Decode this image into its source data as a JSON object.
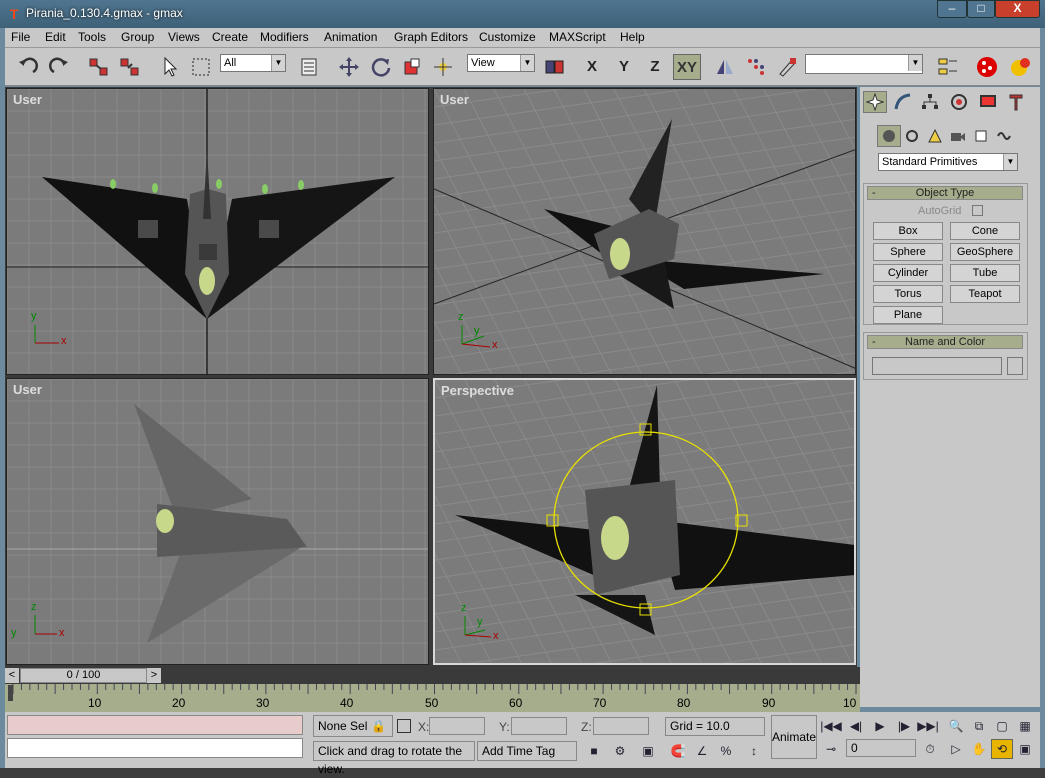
{
  "window": {
    "title": "Pirania_0.130.4.gmax - gmax",
    "min_label": "–",
    "max_label": "□",
    "close_label": "X"
  },
  "menu": [
    "File",
    "Edit",
    "Tools",
    "Group",
    "Views",
    "Create",
    "Modifiers",
    "Animation",
    "Graph Editors",
    "Customize",
    "MAXScript",
    "Help"
  ],
  "toolbar": {
    "selection_filter": "All",
    "ref_coord": "View",
    "axis_x": "X",
    "axis_y": "Y",
    "axis_z": "Z",
    "axis_xy": "XY",
    "named_selection": ""
  },
  "viewports": {
    "top_left": "User",
    "top_right": "User",
    "bottom_left": "User",
    "bottom_right": "Perspective"
  },
  "axes": {
    "x": "x",
    "y": "y",
    "z": "z"
  },
  "command_panel": {
    "category": "Standard Primitives",
    "object_type_title": "Object Type",
    "autogrid_label": "AutoGrid",
    "buttons": [
      "Box",
      "Cone",
      "Sphere",
      "GeoSphere",
      "Cylinder",
      "Tube",
      "Torus",
      "Teapot",
      "Plane"
    ],
    "name_color_title": "Name and Color",
    "collapse": "-"
  },
  "time": {
    "slider_label": "0 / 100",
    "prev": "<",
    "next": ">",
    "ticks": [
      "10",
      "20",
      "30",
      "40",
      "50",
      "60",
      "70",
      "80",
      "90",
      "10"
    ]
  },
  "status": {
    "selection": "None Sel",
    "x_label": "X:",
    "y_label": "Y:",
    "z_label": "Z:",
    "x_value": "",
    "y_value": "",
    "z_value": "",
    "grid": "Grid = 10.0",
    "prompt": "Click and drag to rotate the view.",
    "add_time_tag": "Add Time Tag",
    "animate": "Animate",
    "frame": "0"
  }
}
